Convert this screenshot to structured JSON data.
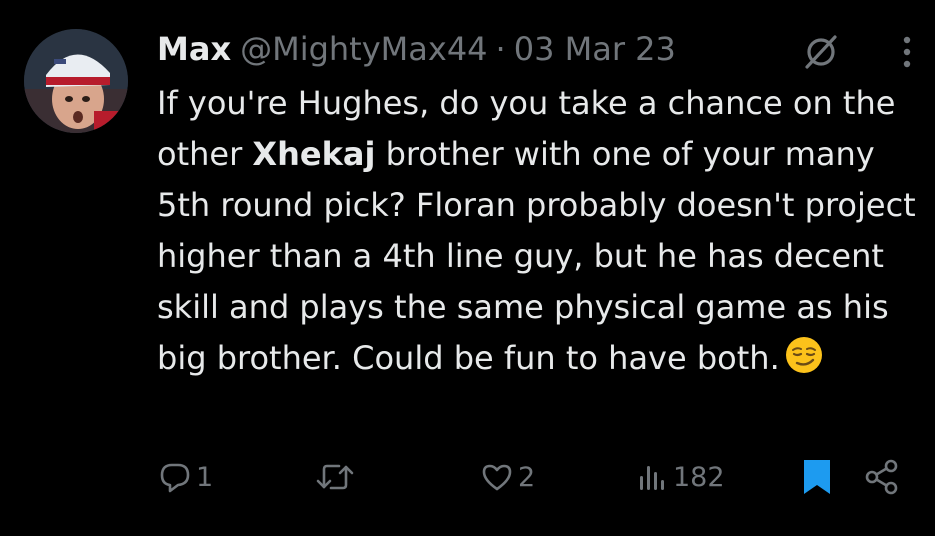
{
  "author": {
    "display_name": "Max",
    "handle": "@MightyMax44",
    "separator": "·",
    "date": "03 Mar 23"
  },
  "tweet": {
    "text_before": "If you're Hughes, do you take a chance on the other ",
    "bold_word": "Xhekaj",
    "text_after": " brother with one of your many 5th round pick? Floran probably doesn't project higher than a 4th line guy, but he has decent skill and plays the same physical game as his big brother. Could be fun to have both.",
    "emoji": "smirking-face"
  },
  "actions": {
    "replies": "1",
    "retweets": "",
    "likes": "2",
    "views": "182",
    "bookmarked": true
  },
  "colors": {
    "background": "#000000",
    "text": "#e7e9ea",
    "muted": "#71767b",
    "accent": "#1d9bf0"
  },
  "icons": [
    "grok-icon",
    "more-icon",
    "reply-icon",
    "retweet-icon",
    "like-icon",
    "views-icon",
    "bookmark-icon",
    "share-icon"
  ]
}
